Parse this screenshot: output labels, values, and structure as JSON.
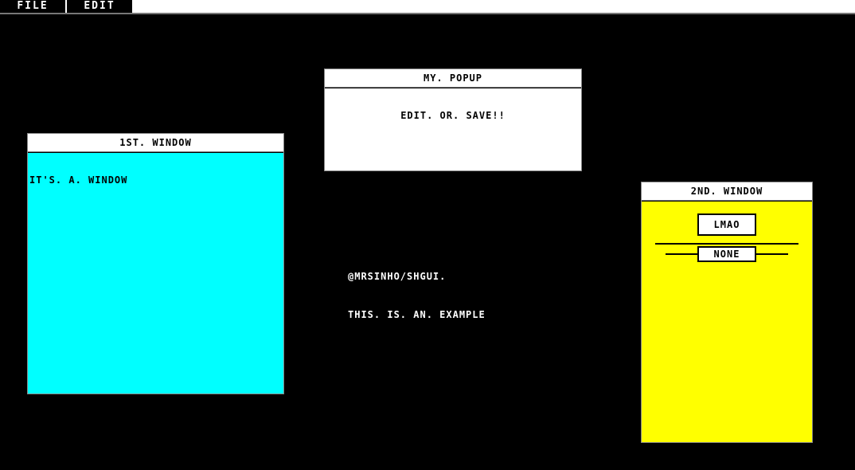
{
  "menu": {
    "file_label": "FILE",
    "edit_label": "EDIT"
  },
  "window1": {
    "title": "1ST. WINDOW",
    "text": "IT'S. A. WINDOW",
    "color": "#00ffff"
  },
  "popup": {
    "title": "MY. POPUP",
    "message": "EDIT. OR. SAVE!!",
    "color": "#ffffff"
  },
  "caption": {
    "line1": "@MRSINHO/SHGUI.",
    "line2": "THIS. IS. AN. EXAMPLE"
  },
  "window2": {
    "title": "2ND. WINDOW",
    "button_label": "LMAO",
    "select_label": "NONE",
    "color": "#ffff00"
  }
}
